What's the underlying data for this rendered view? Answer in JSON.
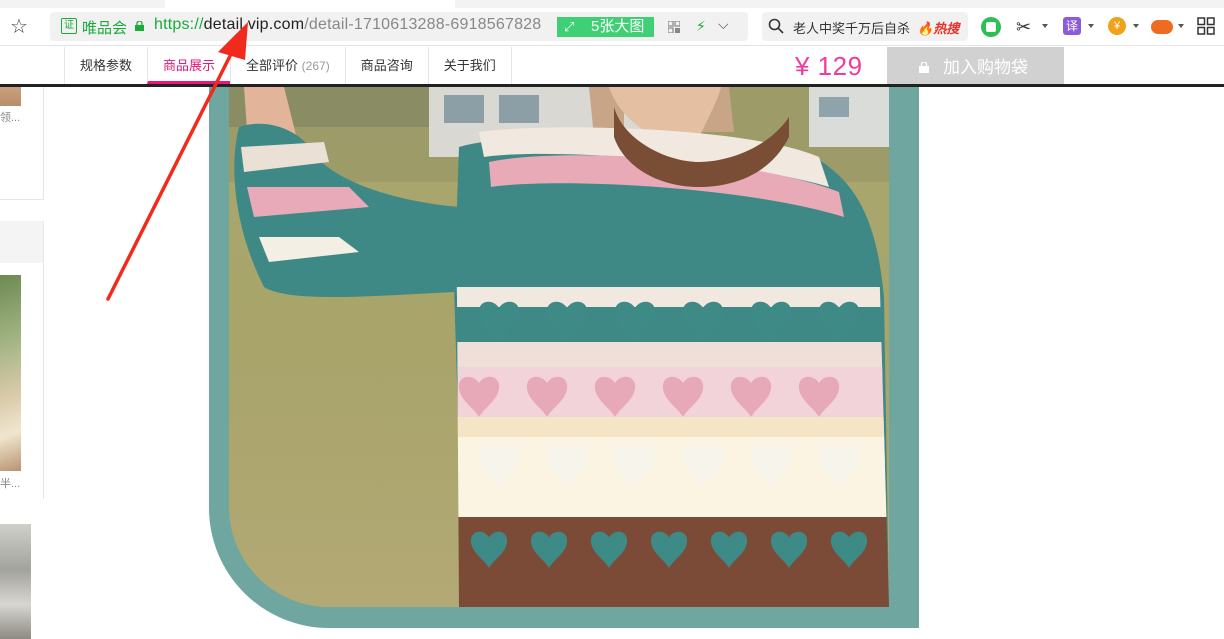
{
  "browser": {
    "site_name": "唯品会",
    "url_protocol": "https://",
    "url_domain": "detail.vip.com",
    "url_path": "/detail-1710613288-6918567828",
    "big_image_label": "5张大图",
    "search_text": "老人中奖千万后自杀",
    "search_hot": "热搜",
    "cert_label": "证",
    "translate_label": "译",
    "icons": [
      "star-icon",
      "lock-icon",
      "expand-icon",
      "qr-code-icon",
      "lightning-icon",
      "chevron-down-icon",
      "search-icon",
      "fire-icon",
      "wechat-icon",
      "scissors-icon",
      "translate-icon",
      "yuan-icon",
      "gamepad-icon",
      "grid-icon"
    ]
  },
  "nav": {
    "tabs": [
      {
        "label": "规格参数",
        "count": ""
      },
      {
        "label": "商品展示",
        "count": ""
      },
      {
        "label": "全部评价",
        "count": "(267)"
      },
      {
        "label": "商品咨询",
        "count": ""
      },
      {
        "label": "关于我们",
        "count": ""
      }
    ],
    "active_tab": 1,
    "price": "¥ 129",
    "add_to_cart": "加入购物袋"
  },
  "sidebar": {
    "item1_caption": "领...",
    "item2_caption": "半..."
  },
  "colors": {
    "accent_pink": "#e8177a",
    "price_pink": "#ef3ca0",
    "url_green": "#1aab3b",
    "frame_teal": "#6fa6a0",
    "annotation_red": "#f02a1c"
  }
}
